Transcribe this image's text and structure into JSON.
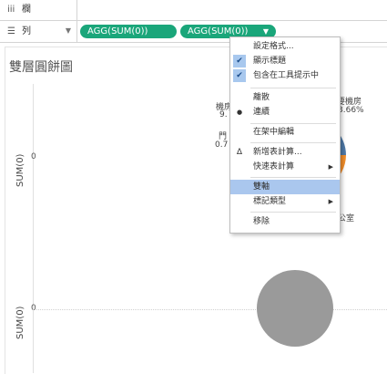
{
  "shelves": {
    "columns_label": "欄",
    "rows_label": "列",
    "pills": [
      "AGG(SUM(0))",
      "AGG(SUM(0))"
    ]
  },
  "view": {
    "title": "雙層圓餅圖",
    "axis_label_top": "SUM(0)",
    "axis_label_bottom": "SUM(0)",
    "zero_top": "0",
    "zero_bottom": "0"
  },
  "pie_labels": {
    "left_1": "機房",
    "left_2": "9.",
    "left_3": "門",
    "left_4": "0.7",
    "right_1": "要機房",
    "right_2": "3.66%",
    "right_3": "公室"
  },
  "context_menu": {
    "items": [
      {
        "label": "設定格式...",
        "icon": ""
      },
      {
        "label": "顯示標題",
        "icon": "check"
      },
      {
        "label": "包含在工具提示中",
        "icon": "check"
      },
      {
        "label": "離散",
        "icon": ""
      },
      {
        "label": "連續",
        "icon": "bullet"
      },
      {
        "label": "在架中編輯",
        "icon": ""
      },
      {
        "label": "新增表計算...",
        "icon": "delta"
      },
      {
        "label": "快速表計算",
        "icon": "",
        "submenu": true
      },
      {
        "label": "雙軸",
        "icon": "",
        "highlighted": true
      },
      {
        "label": "標記類型",
        "icon": "",
        "submenu": true
      },
      {
        "label": "移除",
        "icon": ""
      }
    ],
    "glyphs": {
      "check": "✔",
      "bullet": "●",
      "delta": "Δ",
      "submenu_arrow": "▶"
    }
  },
  "colors": {
    "pill_green": "#1aa67a",
    "menu_highlight": "#aac7ee",
    "pie_gray": "#9a9a9a",
    "pie_orange": "#f28e2b",
    "pie_blue": "#4e79a7"
  }
}
